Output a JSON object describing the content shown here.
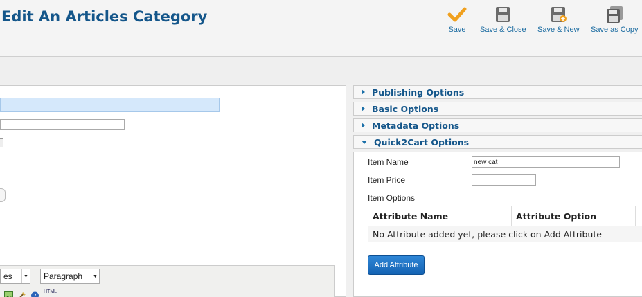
{
  "header": {
    "title": "Edit An Articles Category",
    "toolbar": {
      "save": {
        "label": "Save",
        "icon": "checkmark-icon"
      },
      "save_close": {
        "label": "Save & Close",
        "icon": "floppy-disk-icon"
      },
      "save_new": {
        "label": "Save & New",
        "icon": "floppy-disk-plus-icon"
      },
      "save_copy": {
        "label": "Save as Copy",
        "icon": "floppy-disk-stack-icon"
      }
    }
  },
  "left_panel": {
    "editor": {
      "font_select": "es",
      "format_select": "Paragraph",
      "html_button": "HTML"
    }
  },
  "right_panel": {
    "sections": [
      {
        "label": "Publishing Options",
        "expanded": false
      },
      {
        "label": "Basic Options",
        "expanded": false
      },
      {
        "label": "Metadata Options",
        "expanded": false
      },
      {
        "label": "Quick2Cart Options",
        "expanded": true
      }
    ],
    "quick2cart": {
      "item_name_label": "Item Name",
      "item_name_value": "new cat",
      "item_price_label": "Item Price",
      "item_price_value": "",
      "item_options_label": "Item Options",
      "table": {
        "columns": [
          "Attribute Name",
          "Attribute Option"
        ],
        "empty_message": "No Attribute added yet, please click on Add Attribute"
      },
      "add_attribute_label": "Add Attribute"
    }
  },
  "colors": {
    "title": "#14568a",
    "link": "#1c6ca1",
    "save_check": "#f0a01e",
    "button_blue": "#1463b3",
    "title_input_bg": "#d5e8fb"
  }
}
